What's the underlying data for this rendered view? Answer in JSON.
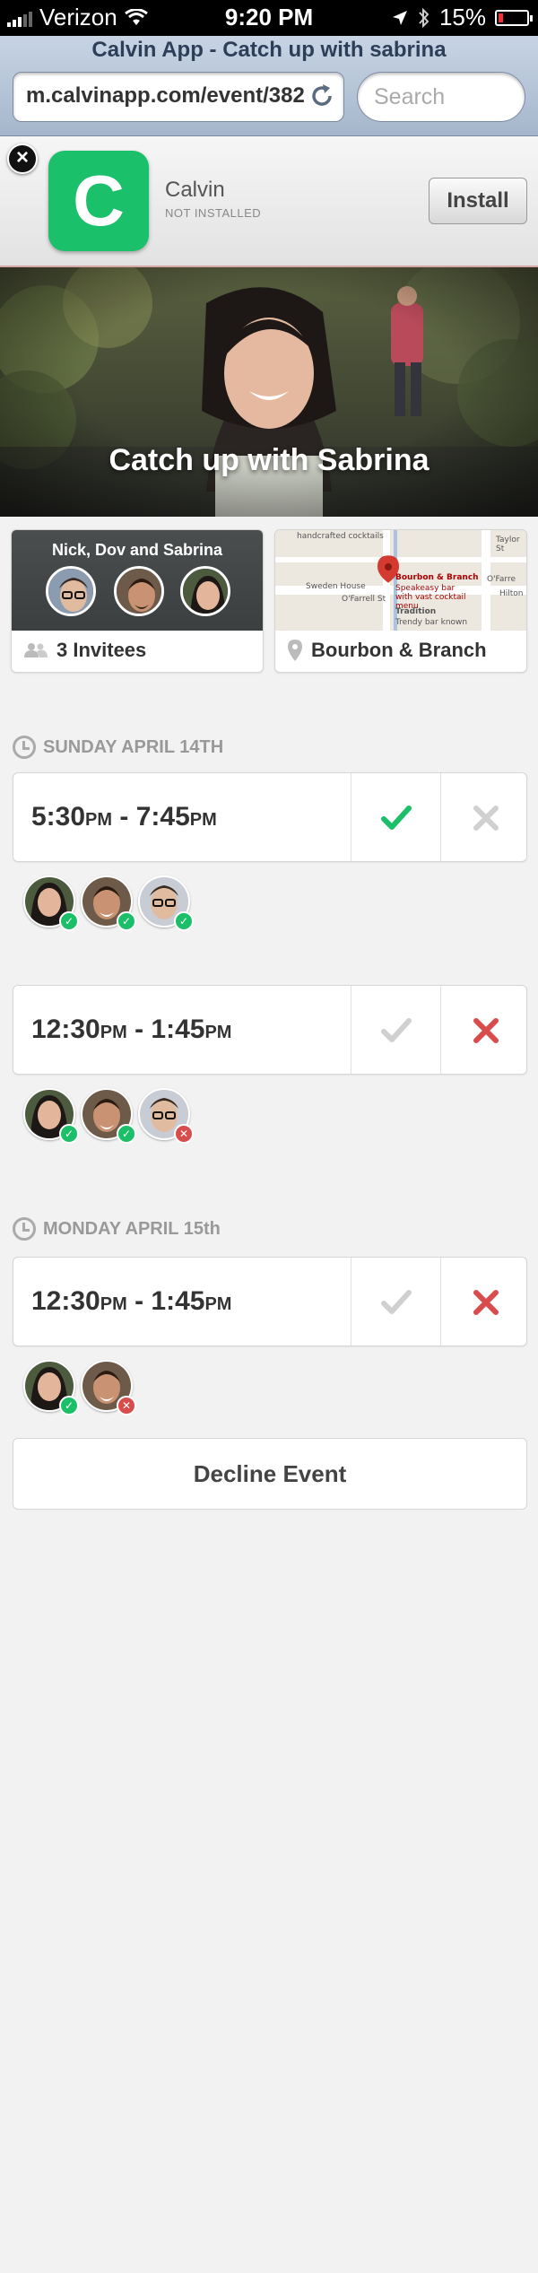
{
  "status_bar": {
    "carrier": "Verizon",
    "time": "9:20 PM",
    "battery": "15%"
  },
  "browser": {
    "title": "Calvin App - Catch up with sabrina",
    "url": "m.calvinapp.com/event/382",
    "search_placeholder": "Search"
  },
  "app_banner": {
    "app_name": "Calvin",
    "app_letter": "C",
    "status": "NOT INSTALLED",
    "install_label": "Install",
    "close_symbol": "×"
  },
  "event": {
    "title": "Catch up with Sabrina",
    "invitees_names": "Nick, Dov and Sabrina",
    "invitees_count": "3 Invitees",
    "location": "Bourbon & Branch",
    "map_labels": {
      "handcrafted": "handcrafted cocktails",
      "sweden_house": "Sweden House",
      "ofarrell": "O'Farrell St",
      "ofarrell2": "O'Farre",
      "taylor": "Taylor St",
      "place_name": "Bourbon & Branch",
      "place_desc": "Speakeasy bar with vast cocktail menu",
      "tradition": "Tradition",
      "tradition_desc": "Trendy bar known",
      "hilton": "Hilton"
    }
  },
  "days": [
    {
      "label": "SUNDAY APRIL 14TH",
      "slots": [
        {
          "start": "5:30",
          "start_ampm": "PM",
          "sep": " - ",
          "end": "7:45",
          "end_ampm": "PM",
          "accepted": true,
          "votes": [
            "yes",
            "yes",
            "yes"
          ]
        },
        {
          "start": "12:30",
          "start_ampm": "PM",
          "sep": " - ",
          "end": "1:45",
          "end_ampm": "PM",
          "accepted": false,
          "votes": [
            "yes",
            "yes",
            "no"
          ]
        }
      ]
    },
    {
      "label": "MONDAY APRIL 15th",
      "slots": [
        {
          "start": "12:30",
          "start_ampm": "PM",
          "sep": " - ",
          "end": "1:45",
          "end_ampm": "PM",
          "accepted": false,
          "votes": [
            "yes",
            "no"
          ]
        }
      ]
    }
  ],
  "decline_label": "Decline Event",
  "colors": {
    "accept": "#1bbf68",
    "decline": "#d94c4c",
    "inactive": "#d0d0d0",
    "brand": "#1bc06a"
  },
  "icons": {
    "check": "check-icon",
    "cross": "cross-icon",
    "clock": "clock-icon",
    "people": "people-icon",
    "pin": "map-pin-icon"
  }
}
